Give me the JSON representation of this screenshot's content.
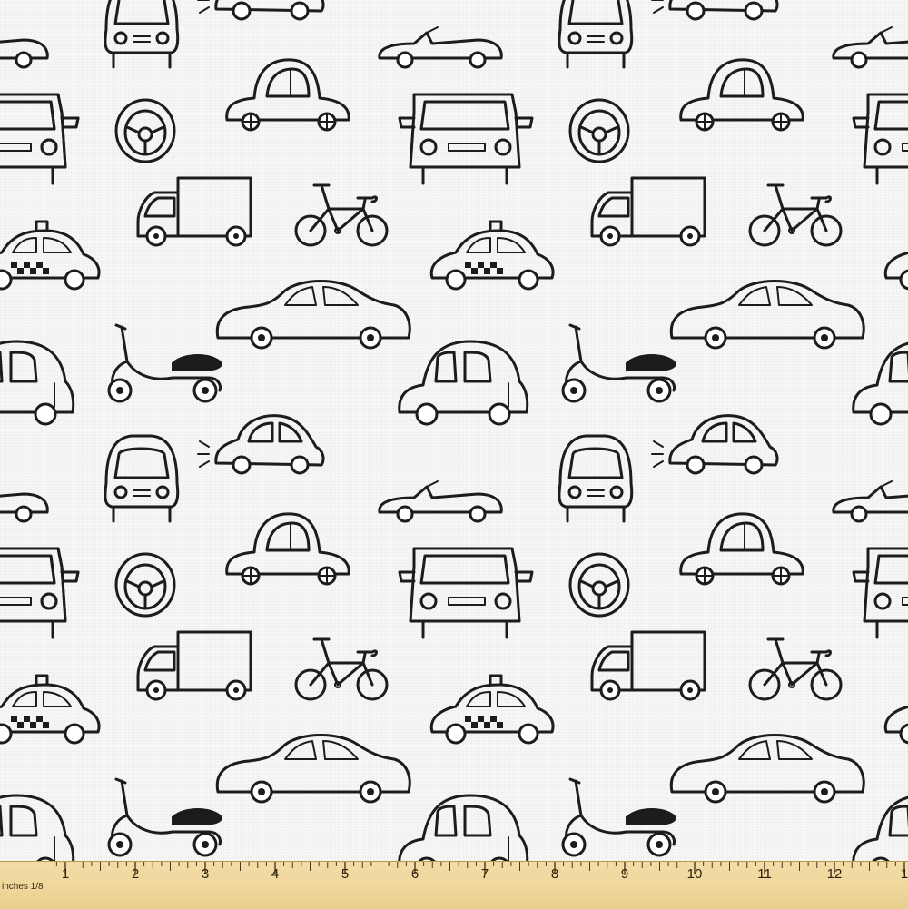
{
  "ruler": {
    "caption": "inches 1/8",
    "numbers": [
      "1",
      "2",
      "3",
      "4",
      "5",
      "6",
      "7",
      "8",
      "9",
      "10",
      "11",
      "12",
      "1"
    ]
  },
  "colors": {
    "ink": "#1c1c1c",
    "fabric": "#f7f7f5",
    "ruler": "#efd69b"
  },
  "pattern": {
    "motifs": [
      "front-car-icon",
      "beetle-car-icon",
      "convertible-car-icon",
      "rounded-car-icon",
      "steering-wheel-icon",
      "truck-icon",
      "bicycle-icon",
      "taxi-icon",
      "sedan-car-icon",
      "scooter-icon",
      "van-car-icon"
    ]
  }
}
